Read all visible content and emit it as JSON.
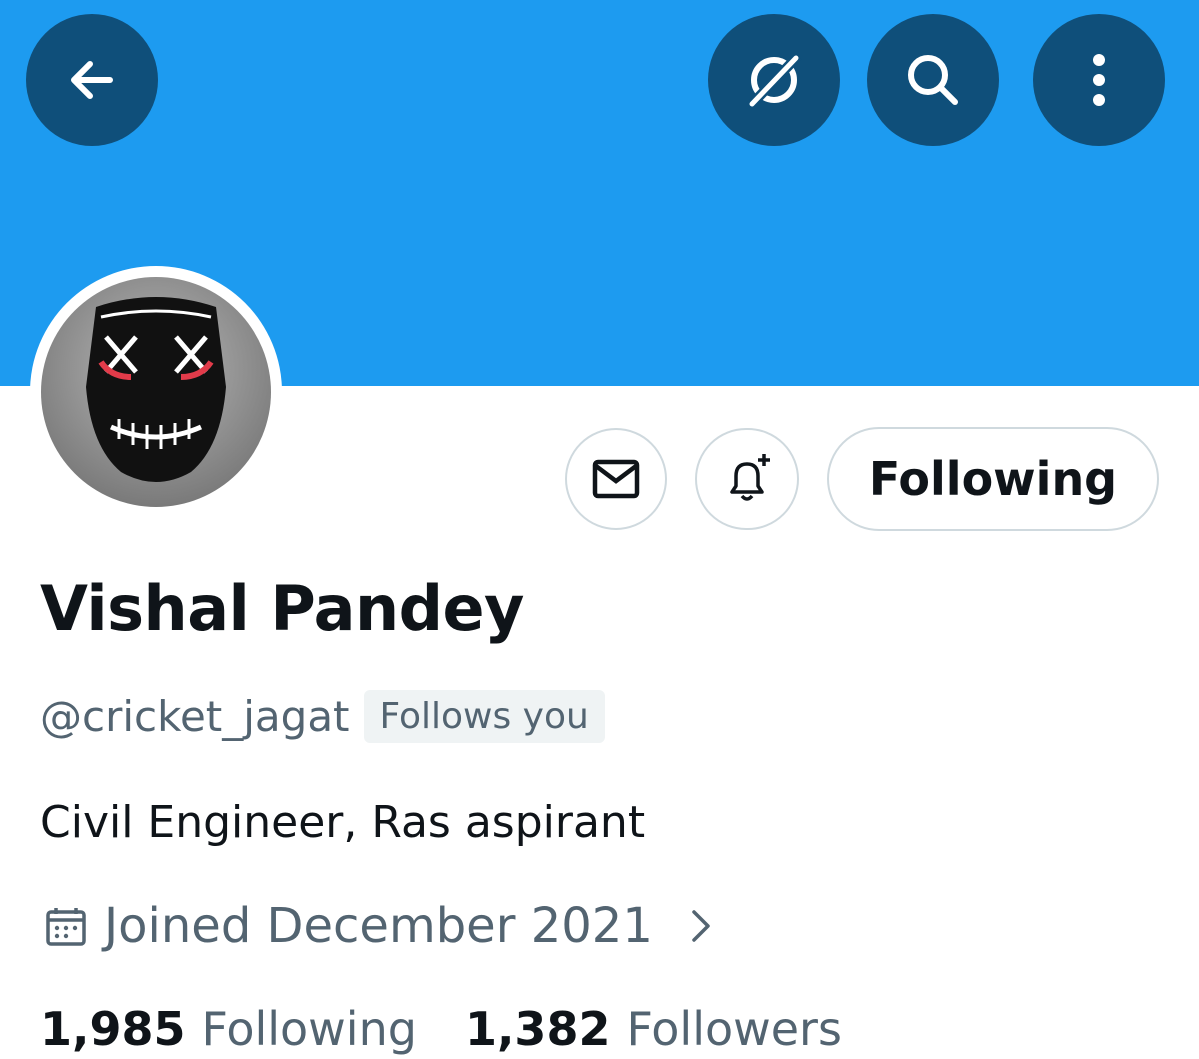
{
  "header": {
    "back_icon": "arrow-left-icon",
    "grok_icon": "grok-icon",
    "search_icon": "search-icon",
    "more_icon": "more-vertical-icon",
    "banner_color": "#1d9bf0",
    "button_color": "#0f4f7a"
  },
  "profile": {
    "display_name": "Vishal Pandey",
    "handle": "@cricket_jagat",
    "follows_you_badge": "Follows you",
    "bio": "Civil Engineer, Ras aspirant",
    "joined": "Joined December 2021",
    "avatar_description_icon": "avatar"
  },
  "actions": {
    "message_icon": "mail-icon",
    "notification_icon": "bell-plus-icon",
    "follow_label": "Following"
  },
  "stats": {
    "following_count": "1,985",
    "following_label": "Following",
    "followers_count": "1,382",
    "followers_label": "Followers"
  }
}
